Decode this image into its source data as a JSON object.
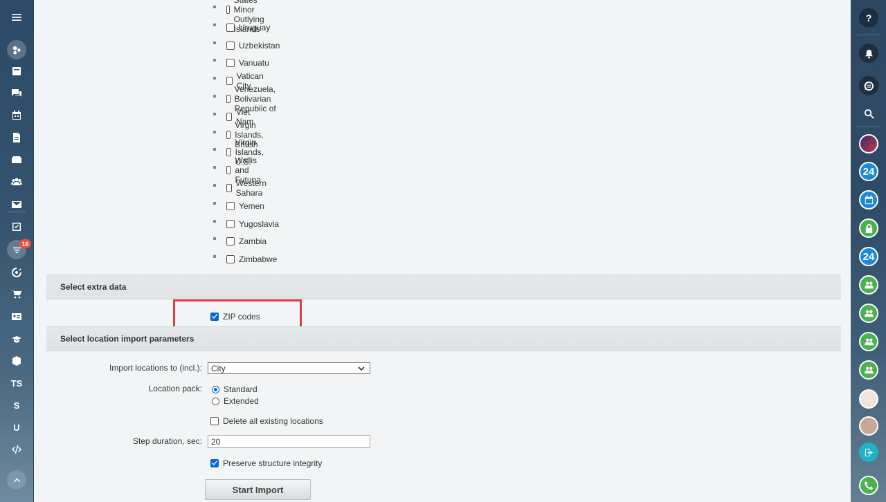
{
  "countries": [
    {
      "label": "United States Minor Outlying Islands",
      "checked": false
    },
    {
      "label": "Uruguay",
      "checked": false
    },
    {
      "label": "Uzbekistan",
      "checked": false
    },
    {
      "label": "Vanuatu",
      "checked": false
    },
    {
      "label": "Vatican City",
      "checked": false
    },
    {
      "label": "Venezuela, Bolivarian Republic of",
      "checked": false
    },
    {
      "label": "Viet Nam",
      "checked": false
    },
    {
      "label": "Virgin Islands, British",
      "checked": false
    },
    {
      "label": "Virgin Islands, U.S.",
      "checked": false
    },
    {
      "label": "Wallis and Futuna",
      "checked": false
    },
    {
      "label": "Western Sahara",
      "checked": false
    },
    {
      "label": "Yemen",
      "checked": false
    },
    {
      "label": "Yugoslavia",
      "checked": false
    },
    {
      "label": "Zambia",
      "checked": false
    },
    {
      "label": "Zimbabwe",
      "checked": false
    }
  ],
  "extra_data": {
    "title": "Select extra data",
    "zip_codes_label": "ZIP codes",
    "zip_codes_checked": true
  },
  "import_params": {
    "title": "Select location import parameters",
    "import_to_label": "Import locations to (incl.):",
    "import_to_value": "City",
    "location_pack_label": "Location pack:",
    "pack_standard": "Standard",
    "pack_extended": "Extended",
    "pack_selected": "Standard",
    "delete_existing_label": "Delete all existing locations",
    "delete_existing_checked": false,
    "step_duration_label": "Step duration, sec:",
    "step_duration_value": "20",
    "preserve_label": "Preserve structure integrity",
    "preserve_checked": true,
    "start_button": "Start Import"
  },
  "left_sidebar": {
    "items": [
      "menu-icon",
      "feed-icon",
      "tasks-icon",
      "chat-icon",
      "calendar-icon",
      "documents-icon",
      "drive-icon",
      "employees-icon",
      "mail-icon",
      "checklist-icon",
      "crm-icon",
      "target-icon",
      "shop-icon",
      "contact-card-icon",
      "learning-icon",
      "box-icon"
    ],
    "text_items": [
      "TS",
      "S",
      "U"
    ],
    "badge": "16"
  },
  "right_sidebar": {
    "help": "?",
    "bitrix_label": "24"
  },
  "colors": {
    "accent": "#0a66d8",
    "highlight": "#e03a44",
    "badge": "#f04b3c"
  }
}
